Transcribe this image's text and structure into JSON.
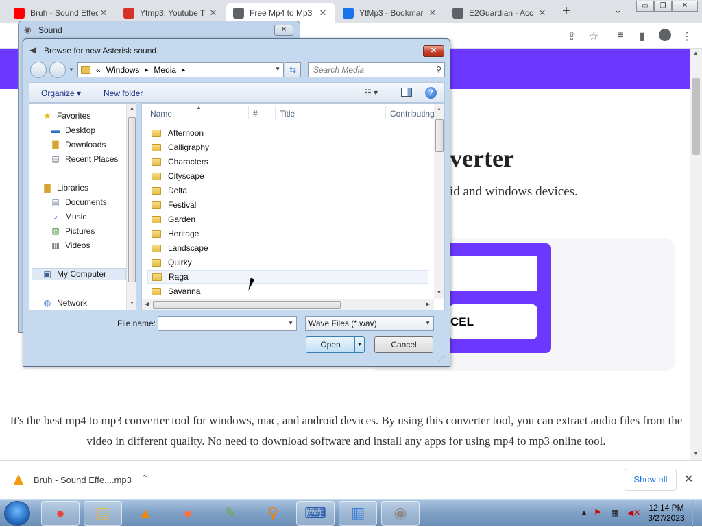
{
  "browser": {
    "tabs": [
      {
        "title": "Bruh - Sound Effect",
        "favicon_color": "#ff0000",
        "active": false
      },
      {
        "title": "Ytmp3: Youtube T",
        "favicon_color": "#d93025",
        "active": false
      },
      {
        "title": "Free Mp4 to Mp3",
        "favicon_color": "#5f6368",
        "active": true
      },
      {
        "title": "YtMp3 - Bookmar",
        "favicon_color": "#1a73e8",
        "active": false
      },
      {
        "title": "E2Guardian - Acc",
        "favicon_color": "#5f6368",
        "active": false
      }
    ],
    "new_tab": "+",
    "tab_list": "⌄",
    "window_buttons": [
      "▭",
      "❐",
      "✕"
    ]
  },
  "toolbar": {
    "share": "⇪",
    "star": "☆",
    "media": "≡",
    "sidepanel": "▮",
    "menu": "⋮"
  },
  "page": {
    "accent": "#6c38ff",
    "heading": "verter",
    "subheading": "id and windows devices.",
    "cancel_label": "CEL",
    "paragraph": "It's the best mp4 to mp3 converter tool for windows, mac, and android devices. By using this converter tool, you can extract audio files from the video in different quality. No need to download software and install any apps for using mp4 to mp3 online tool."
  },
  "download_bar": {
    "file_name": "Bruh - Sound Effe....mp3",
    "show_all": "Show all",
    "close": "✕",
    "chevron": "⌃"
  },
  "taskbar": {
    "time": "12:14 PM",
    "date": "3/27/2023",
    "apps": [
      {
        "name": "chrome",
        "glyph": "●",
        "color": "#e8453c"
      },
      {
        "name": "explorer",
        "glyph": "▤",
        "color": "#e2b84a"
      },
      {
        "name": "vlc",
        "glyph": "▲",
        "color": "#f08a00"
      },
      {
        "name": "firefox",
        "glyph": "●",
        "color": "#ff7139"
      },
      {
        "name": "notepadpp",
        "glyph": "✎",
        "color": "#6aa84f"
      },
      {
        "name": "search",
        "glyph": "⚲",
        "color": "#f57c00"
      },
      {
        "name": "keyboard",
        "glyph": "⌨",
        "color": "#2b5ba8"
      },
      {
        "name": "control-panel",
        "glyph": "▦",
        "color": "#3b7dd8"
      },
      {
        "name": "sound",
        "glyph": "◉",
        "color": "#8c8c8c"
      }
    ]
  },
  "sound_dialog": {
    "title": "Sound",
    "close": "✕"
  },
  "browse_dialog": {
    "title": "Browse for new Asterisk sound.",
    "close": "✕",
    "breadcrumb": {
      "prefix": "«",
      "parts": [
        "Windows",
        "Media"
      ],
      "sep": "▸"
    },
    "search_placeholder": "Search Media",
    "organize": "Organize ▾",
    "new_folder": "New folder",
    "help": "?",
    "nav": {
      "favorites": "Favorites",
      "desktop": "Desktop",
      "downloads": "Downloads",
      "recent": "Recent Places",
      "libraries": "Libraries",
      "documents": "Documents",
      "music": "Music",
      "pictures": "Pictures",
      "videos": "Videos",
      "my_computer": "My Computer",
      "network": "Network"
    },
    "columns": {
      "name": "Name",
      "num": "#",
      "title": "Title",
      "contrib": "Contributing"
    },
    "folders": [
      "Afternoon",
      "Calligraphy",
      "Characters",
      "Cityscape",
      "Delta",
      "Festival",
      "Garden",
      "Heritage",
      "Landscape",
      "Quirky",
      "Raga",
      "Savanna"
    ],
    "file_name_label": "File name:",
    "file_name_value": "",
    "filter": "Wave Files (*.wav)",
    "open": "Open",
    "cancel": "Cancel"
  }
}
